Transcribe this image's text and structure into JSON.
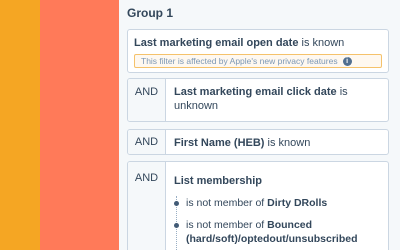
{
  "group": {
    "title": "Group 1"
  },
  "conditions": [
    {
      "property": "Last marketing email open date",
      "operator": "is known",
      "notice": "This filter is affected by Apple's new privacy features"
    },
    {
      "connector": "AND",
      "property": "Last marketing email click date",
      "operator": "is unknown"
    },
    {
      "connector": "AND",
      "property": "First Name (HEB)",
      "operator": "is known"
    },
    {
      "connector": "AND",
      "property": "List membership",
      "items": [
        {
          "operator": "is not member of",
          "list": "Dirty DRolls"
        },
        {
          "operator": "is not member of",
          "list": "Bounced (hard/soft)/optedout/unsubscribed"
        }
      ]
    }
  ],
  "colors": {
    "left_strip": "#f5a623",
    "coral_strip": "#ff7a59",
    "notice_border": "#f5c26b"
  }
}
